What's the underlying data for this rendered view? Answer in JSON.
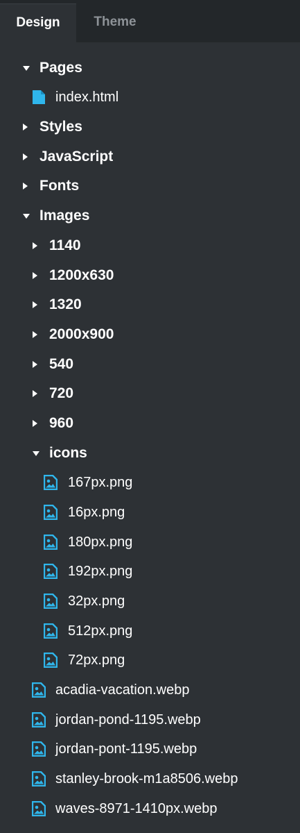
{
  "tabs": {
    "design": "Design",
    "theme": "Theme"
  },
  "tree": [
    {
      "label": "Pages",
      "type": "folder",
      "expanded": true,
      "icon": "caret-down-icon"
    },
    {
      "label": "index.html",
      "type": "file",
      "icon": "file-icon"
    },
    {
      "label": "Styles",
      "type": "folder",
      "expanded": false,
      "icon": "caret-right-icon"
    },
    {
      "label": "JavaScript",
      "type": "folder",
      "expanded": false,
      "icon": "caret-right-icon"
    },
    {
      "label": "Fonts",
      "type": "folder",
      "expanded": false,
      "icon": "caret-right-icon"
    },
    {
      "label": "Images",
      "type": "folder",
      "expanded": true,
      "icon": "caret-down-icon"
    },
    {
      "label": "1140",
      "type": "folder",
      "expanded": false,
      "icon": "caret-right-icon"
    },
    {
      "label": "1200x630",
      "type": "folder",
      "expanded": false,
      "icon": "caret-right-icon"
    },
    {
      "label": "1320",
      "type": "folder",
      "expanded": false,
      "icon": "caret-right-icon"
    },
    {
      "label": "2000x900",
      "type": "folder",
      "expanded": false,
      "icon": "caret-right-icon"
    },
    {
      "label": "540",
      "type": "folder",
      "expanded": false,
      "icon": "caret-right-icon"
    },
    {
      "label": "720",
      "type": "folder",
      "expanded": false,
      "icon": "caret-right-icon"
    },
    {
      "label": "960",
      "type": "folder",
      "expanded": false,
      "icon": "caret-right-icon"
    },
    {
      "label": "icons",
      "type": "folder",
      "expanded": true,
      "icon": "caret-down-icon"
    },
    {
      "label": "167px.png",
      "type": "file",
      "icon": "image-icon"
    },
    {
      "label": "16px.png",
      "type": "file",
      "icon": "image-icon"
    },
    {
      "label": "180px.png",
      "type": "file",
      "icon": "image-icon"
    },
    {
      "label": "192px.png",
      "type": "file",
      "icon": "image-icon"
    },
    {
      "label": "32px.png",
      "type": "file",
      "icon": "image-icon"
    },
    {
      "label": "512px.png",
      "type": "file",
      "icon": "image-icon"
    },
    {
      "label": "72px.png",
      "type": "file",
      "icon": "image-icon"
    },
    {
      "label": "acadia-vacation.webp",
      "type": "file",
      "icon": "image-icon"
    },
    {
      "label": "jordan-pond-1195.webp",
      "type": "file",
      "icon": "image-icon"
    },
    {
      "label": "jordan-pont-1195.webp",
      "type": "file",
      "icon": "image-icon"
    },
    {
      "label": "stanley-brook-m1a8506.webp",
      "type": "file",
      "icon": "image-icon"
    },
    {
      "label": "waves-8971-1410px.webp",
      "type": "file",
      "icon": "image-icon"
    }
  ],
  "colors": {
    "background": "#2d3135",
    "tabbar": "#23272a",
    "icon_accent": "#2fb6ec",
    "inactive_tab": "#8d9297"
  }
}
